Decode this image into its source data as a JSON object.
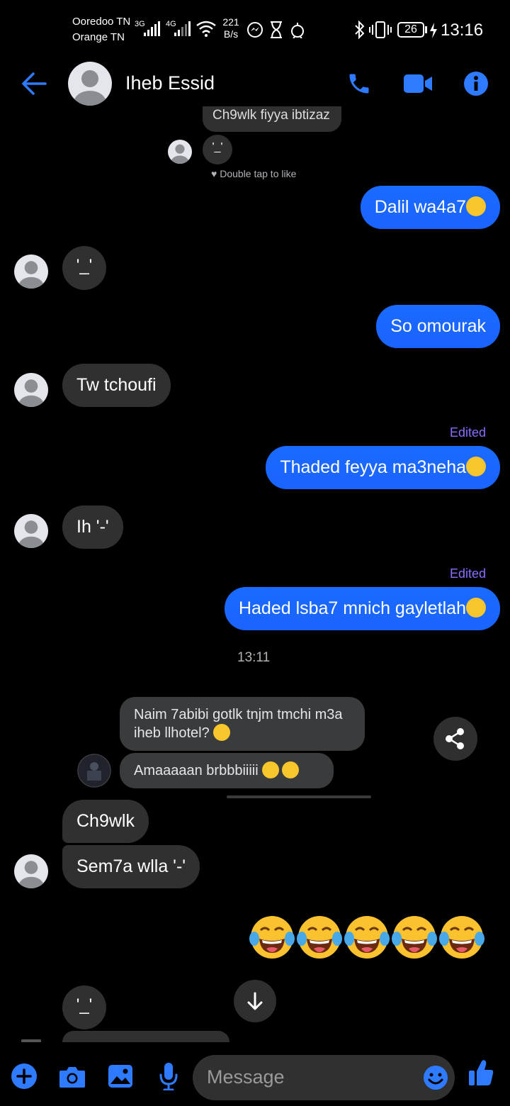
{
  "status_bar": {
    "carrier1": "Ooredoo TN",
    "carrier2": "Orange TN",
    "net1": "3G",
    "net2": "4G",
    "speed_value": "221",
    "speed_unit": "B/s",
    "battery": "26",
    "time": "13:16"
  },
  "header": {
    "contact_name": "Iheb Essid"
  },
  "colors": {
    "accent": "#1a6bff",
    "incoming_bubble": "#303030",
    "edited_label": "#8c6cff"
  },
  "messages": {
    "partial_top": "Ch9wlk fiyya ibtizaz",
    "top_reaction": "'_'",
    "double_tap": "Double tap to like",
    "m1": "Dalil wa4a7",
    "m2": "'_'",
    "m3": "So omourak",
    "m4": "Tw tchoufi",
    "edited1": "Edited",
    "m5": "Thaded feyya ma3neha",
    "m6": "Ih '-'",
    "edited2": "Edited",
    "m7": "Haded lsba7 mnich gayletlah",
    "timestamp": "13:11",
    "fwd1": "Naim 7abibi gotlk tnjm tmchi m3a iheb llhotel?",
    "fwd2": "Amaaaaan brbbbiiiii",
    "m8": "Ch9wlk",
    "m9": "Sem7a wlla '-'",
    "m10": "'_'"
  },
  "composer": {
    "placeholder": "Message"
  }
}
